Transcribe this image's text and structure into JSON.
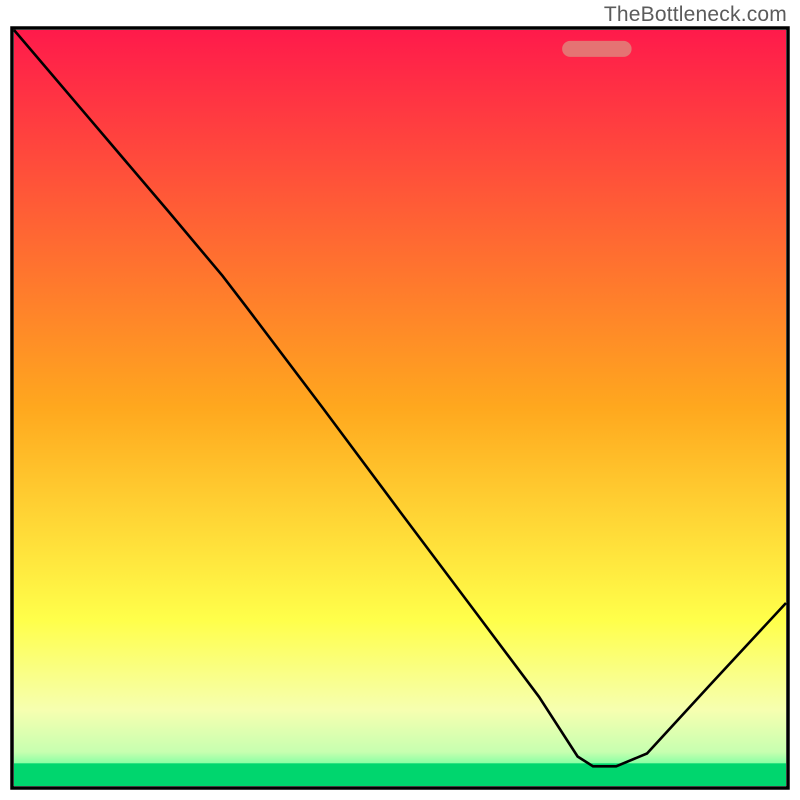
{
  "watermark": "TheBottleneck.com",
  "chart_data": {
    "type": "line",
    "title": "",
    "xlabel": "",
    "ylabel": "",
    "xlim": [
      0,
      100
    ],
    "ylim": [
      0,
      100
    ],
    "grid": false,
    "legend": false,
    "background_gradient": {
      "stops": [
        {
          "offset": 0.0,
          "color": "#ff1a4b"
        },
        {
          "offset": 0.5,
          "color": "#ffa81e"
        },
        {
          "offset": 0.78,
          "color": "#ffff4a"
        },
        {
          "offset": 0.9,
          "color": "#f6ffb0"
        },
        {
          "offset": 0.955,
          "color": "#c7ffb0"
        },
        {
          "offset": 0.985,
          "color": "#4dff99"
        },
        {
          "offset": 1.0,
          "color": "#00e676"
        }
      ]
    },
    "bottom_band": {
      "start_y": 97,
      "end_y": 100,
      "color": "#00d66e"
    },
    "marker": {
      "x_start": 71,
      "x_end": 80,
      "y": 97.5,
      "color": "#e57373",
      "shape": "rounded-bar"
    },
    "series": [
      {
        "name": "curve",
        "color": "#000000",
        "stroke_width": 2.6,
        "points": [
          {
            "x": 0,
            "y": 100
          },
          {
            "x": 10,
            "y": 88
          },
          {
            "x": 20,
            "y": 76
          },
          {
            "x": 27,
            "y": 67.5
          },
          {
            "x": 30,
            "y": 63.5
          },
          {
            "x": 40,
            "y": 50
          },
          {
            "x": 50,
            "y": 36.3
          },
          {
            "x": 60,
            "y": 22.7
          },
          {
            "x": 68,
            "y": 11.8
          },
          {
            "x": 73,
            "y": 3.9
          },
          {
            "x": 75,
            "y": 2.6
          },
          {
            "x": 78,
            "y": 2.6
          },
          {
            "x": 82,
            "y": 4.3
          },
          {
            "x": 90,
            "y": 13.2
          },
          {
            "x": 100,
            "y": 24.2
          }
        ]
      }
    ]
  }
}
